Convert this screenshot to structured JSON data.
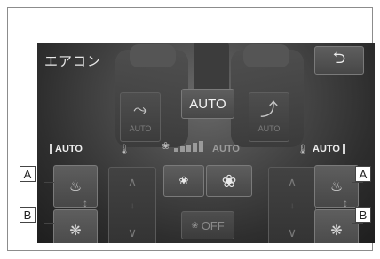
{
  "screen": {
    "title": "エアコン",
    "back_icon": "return-arrow-icon",
    "auto_button": "AUTO",
    "seat_swing_left": {
      "icon": "seat-recline-icon",
      "label": "AUTO"
    },
    "seat_swing_right": {
      "icon": "seat-recline-icon",
      "label": "AUTO"
    },
    "left_auto": "AUTO",
    "right_auto": "AUTO",
    "fan_auto": "AUTO",
    "fan_level_bars": 5,
    "off_button": "OFF"
  },
  "callouts": {
    "top_left": "A",
    "bottom_left": "B",
    "top_right": "A",
    "bottom_right": "B"
  },
  "icons": {
    "seat_heater": "seat-heater-icon",
    "seat_ventilation": "seat-ventilation-icon",
    "fan_small": "fan-small-icon",
    "fan_large": "fan-large-icon",
    "thermometer": "thermometer-icon"
  }
}
